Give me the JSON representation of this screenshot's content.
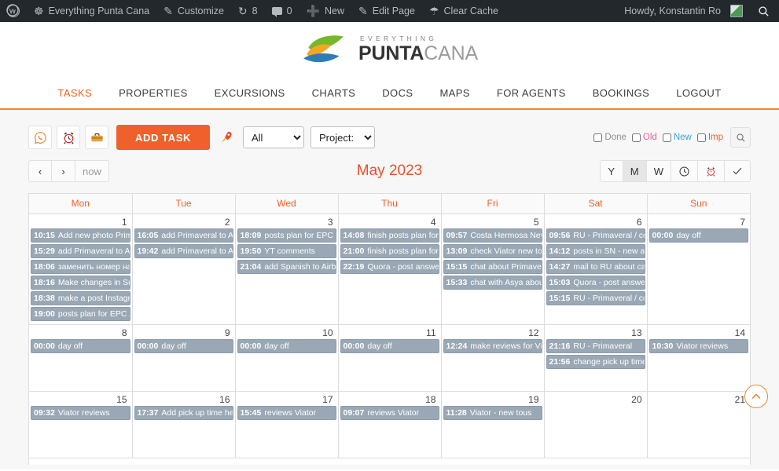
{
  "adminbar": {
    "wp_logo": "wordpress-icon",
    "site_name": "Everything Punta Cana",
    "customize": "Customize",
    "updates_count": "8",
    "comments_count": "0",
    "new": "New",
    "edit_page": "Edit Page",
    "clear_cache": "Clear Cache",
    "howdy": "Howdy, Konstantin Ro",
    "search_icon": "search-icon"
  },
  "logo": {
    "tagline": "EVERYTHING",
    "name_bold": "PUNTA",
    "name_light": "CANA"
  },
  "nav": {
    "items": [
      {
        "label": "TASKS",
        "active": true
      },
      {
        "label": "PROPERTIES",
        "active": false
      },
      {
        "label": "EXCURSIONS",
        "active": false
      },
      {
        "label": "CHARTS",
        "active": false
      },
      {
        "label": "DOCS",
        "active": false
      },
      {
        "label": "MAPS",
        "active": false
      },
      {
        "label": "FOR AGENTS",
        "active": false
      },
      {
        "label": "BOOKINGS",
        "active": false
      },
      {
        "label": "LOGOUT",
        "active": false
      }
    ]
  },
  "toolbar": {
    "whatsapp_icon": "whatsapp-icon",
    "alarm_icon": "alarm-clock-icon",
    "briefcase_icon": "briefcase-icon",
    "add_task": "ADD TASK",
    "rocket_icon": "rocket-icon",
    "filter_all": "All",
    "filter_all_options": [
      "All"
    ],
    "filter_project": "Project:",
    "filter_project_options": [
      "Project:"
    ],
    "checkboxes": [
      {
        "label": "Done",
        "checked": false,
        "color": "#8d8d8d",
        "cls": "done"
      },
      {
        "label": "Old",
        "checked": false,
        "color": "#e85f9c",
        "cls": "old"
      },
      {
        "label": "New",
        "checked": false,
        "color": "#3aa0e8",
        "cls": "new"
      },
      {
        "label": "Imp",
        "checked": false,
        "color": "#f0602c",
        "cls": "imp"
      }
    ],
    "search_icon": "search-icon"
  },
  "calendar_controls": {
    "prev": "‹",
    "next": "›",
    "now": "now",
    "title": "May 2023",
    "views": [
      {
        "label": "Y",
        "active": false
      },
      {
        "label": "M",
        "active": true
      },
      {
        "label": "W",
        "active": false
      }
    ],
    "clock_icon": "clock-icon",
    "alarm_icon": "alarm-clock-icon",
    "check_icon": "check-icon"
  },
  "scroll_top_icon": "chevron-up-icon",
  "calendar": {
    "weekdays": [
      "Mon",
      "Tue",
      "Wed",
      "Thu",
      "Fri",
      "Sat",
      "Sun"
    ],
    "weeks": [
      [
        {
          "num": "1",
          "events": [
            {
              "time": "10:15",
              "text": "Add new photo Primaveral"
            },
            {
              "time": "15:29",
              "text": "add Primaveral to Airbnb"
            },
            {
              "time": "18:06",
              "text": "заменить номер на Viator"
            },
            {
              "time": "18:16",
              "text": "Make changes in Surfing"
            },
            {
              "time": "18:38",
              "text": "make a post Instagram EPC"
            },
            {
              "time": "19:00",
              "text": "posts plan for EPC / CHM"
            }
          ]
        },
        {
          "num": "2",
          "events": [
            {
              "time": "16:05",
              "text": "add Primaveral to Airbnb"
            },
            {
              "time": "19:42",
              "text": "add Primaveral to Airbnb"
            }
          ]
        },
        {
          "num": "3",
          "events": [
            {
              "time": "18:09",
              "text": "posts plan for EPC / CHM"
            },
            {
              "time": "19:50",
              "text": "YT comments"
            },
            {
              "time": "21:04",
              "text": "add Spanish to Airbnb Pr"
            }
          ]
        },
        {
          "num": "4",
          "events": [
            {
              "time": "14:08",
              "text": "finish posts plan for EPC"
            },
            {
              "time": "21:00",
              "text": "finish posts plan for EPC"
            },
            {
              "time": "22:19",
              "text": "Quora - post answers"
            }
          ]
        },
        {
          "num": "5",
          "events": [
            {
              "time": "09:57",
              "text": "Costa Hermosa New pho"
            },
            {
              "time": "13:09",
              "text": "check Viator new tours"
            },
            {
              "time": "15:15",
              "text": "chat about Primaveral Vi"
            },
            {
              "time": "15:33",
              "text": "chat with Asya about the"
            }
          ]
        },
        {
          "num": "6",
          "events": [
            {
              "time": "09:56",
              "text": "RU - Primaveral / connec"
            },
            {
              "time": "14:12",
              "text": "posts in SN - new articles"
            },
            {
              "time": "14:27",
              "text": "mail to RU about calenda"
            },
            {
              "time": "15:03",
              "text": "Quora - post answers"
            },
            {
              "time": "15:15",
              "text": "RU - Primaveral / connec"
            }
          ]
        },
        {
          "num": "7",
          "events": [
            {
              "time": "00:00",
              "text": "day off"
            }
          ]
        }
      ],
      [
        {
          "num": "8",
          "events": [
            {
              "time": "00:00",
              "text": "day off"
            }
          ]
        },
        {
          "num": "9",
          "events": [
            {
              "time": "00:00",
              "text": "day off"
            }
          ]
        },
        {
          "num": "10",
          "events": [
            {
              "time": "00:00",
              "text": "day off"
            }
          ]
        },
        {
          "num": "11",
          "events": [
            {
              "time": "00:00",
              "text": "day off"
            }
          ]
        },
        {
          "num": "12",
          "events": [
            {
              "time": "12:24",
              "text": "make reviews for Viator A"
            }
          ]
        },
        {
          "num": "13",
          "events": [
            {
              "time": "21:16",
              "text": "RU - Primaveral"
            },
            {
              "time": "21:56",
              "text": "change pick up time for h"
            }
          ]
        },
        {
          "num": "14",
          "events": [
            {
              "time": "10:30",
              "text": "Viator reviews"
            }
          ]
        }
      ],
      [
        {
          "num": "15",
          "events": [
            {
              "time": "09:32",
              "text": "Viator reviews"
            }
          ]
        },
        {
          "num": "16",
          "events": [
            {
              "time": "17:37",
              "text": "Add pick up time helicop"
            }
          ]
        },
        {
          "num": "17",
          "events": [
            {
              "time": "15:45",
              "text": "reviews Viator"
            }
          ]
        },
        {
          "num": "18",
          "events": [
            {
              "time": "09:07",
              "text": "reviews Viator"
            }
          ]
        },
        {
          "num": "19",
          "events": [
            {
              "time": "11:28",
              "text": "Viator - new tous"
            }
          ]
        },
        {
          "num": "20",
          "events": []
        },
        {
          "num": "21",
          "events": []
        }
      ]
    ]
  }
}
